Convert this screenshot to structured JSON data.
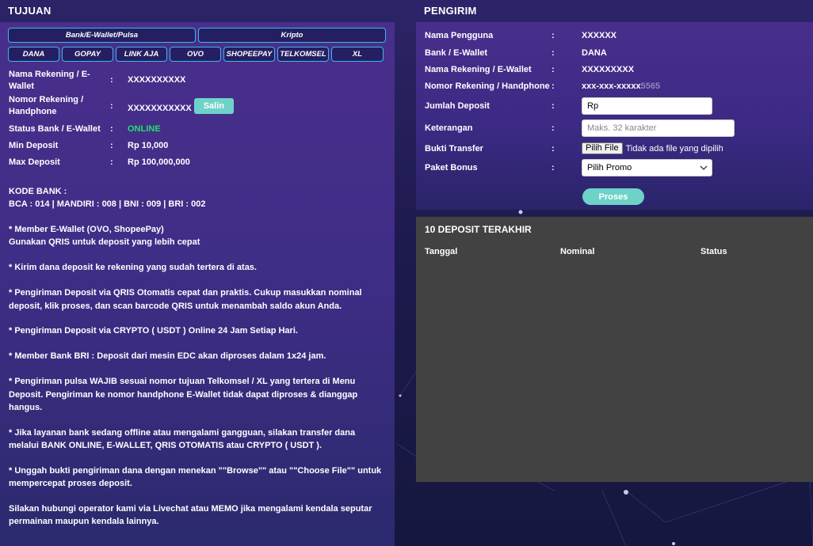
{
  "tujuan": {
    "title": "TUJUAN",
    "top_tabs": [
      "Bank/E-Wallet/Pulsa",
      "Kripto"
    ],
    "sub_tabs": [
      "DANA",
      "GOPAY",
      "LINK AJA",
      "OVO",
      "SHOPEEPAY",
      "TELKOMSEL",
      "XL"
    ],
    "rows": {
      "nama_label": "Nama Rekening / E-Wallet",
      "nama_value": "XXXXXXXXXX",
      "nomor_label": "Nomor Rekening / Handphone",
      "nomor_value": "XXXXXXXXXXX",
      "salin_label": "Salin",
      "status_label": "Status Bank / E-Wallet",
      "status_value": "ONLINE",
      "min_label": "Min Deposit",
      "min_value": "Rp 10,000",
      "max_label": "Max Deposit",
      "max_value": "Rp 100,000,000",
      "colon": ":"
    },
    "notes": {
      "kode_title": "KODE BANK :",
      "kode_list": "BCA : 014 | MANDIRI : 008 | BNI : 009 | BRI : 002",
      "ewallet_1": "* Member E-Wallet (OVO, ShopeePay)",
      "ewallet_2": "Gunakan QRIS untuk deposit yang lebih cepat",
      "n1": "* Kirim dana deposit ke rekening yang sudah tertera di atas.",
      "n2": "* Pengiriman Deposit via QRIS Otomatis cepat dan praktis. Cukup masukkan nominal deposit, klik proses, dan scan barcode QRIS untuk menambah saldo akun Anda.",
      "n3": "* Pengiriman Deposit via CRYPTO ( USDT ) Online 24 Jam Setiap Hari.",
      "n4": "* Member Bank BRI : Deposit dari mesin EDC akan diproses dalam 1x24 jam.",
      "n5": "* Pengiriman pulsa WAJIB sesuai nomor tujuan Telkomsel / XL yang tertera di Menu Deposit. Pengiriman ke nomor handphone E-Wallet tidak dapat diproses & dianggap hangus.",
      "n6": "* Jika layanan bank sedang offline atau mengalami gangguan, silakan transfer dana melalui BANK ONLINE, E-WALLET, QRIS OTOMATIS atau CRYPTO ( USDT ).",
      "n7": "* Unggah bukti pengiriman dana dengan menekan \"\"Browse\"\" atau \"\"Choose File\"\" untuk mempercepat proses deposit.",
      "n8": "Silakan hubungi operator kami via Livechat atau MEMO jika mengalami kendala seputar permainan maupun kendala lainnya."
    }
  },
  "pengirim": {
    "title": "PENGIRIM",
    "colon": ":",
    "nama_pengguna_label": "Nama Pengguna",
    "nama_pengguna_value": "XXXXXX",
    "bank_label": "Bank / E-Wallet",
    "bank_value": "DANA",
    "nama_rek_label": "Nama Rekening / E-Wallet",
    "nama_rek_value": "XXXXXXXXX",
    "nomor_rek_label": "Nomor Rekening / Handphone",
    "nomor_rek_value": "xxx-xxx-xxxxx",
    "nomor_rek_masked": "5565",
    "jumlah_label": "Jumlah Deposit",
    "jumlah_value": "Rp",
    "keterangan_label": "Keterangan",
    "keterangan_placeholder": "Maks. 32 karakter",
    "bukti_label": "Bukti Transfer",
    "file_button": "Pilih File",
    "file_status": "Tidak ada file yang dipilih",
    "paket_label": "Paket Bonus",
    "paket_value": "Pilih Promo",
    "proses_label": "Proses"
  },
  "deposit": {
    "title": "10 DEPOSIT TERAKHIR",
    "columns": [
      "Tanggal",
      "Nominal",
      "Status"
    ]
  },
  "colors": {
    "accent_teal": "#6fd2c8",
    "tab_border": "#3fb7e6",
    "online": "#22e06a",
    "table_bg": "#424242"
  }
}
